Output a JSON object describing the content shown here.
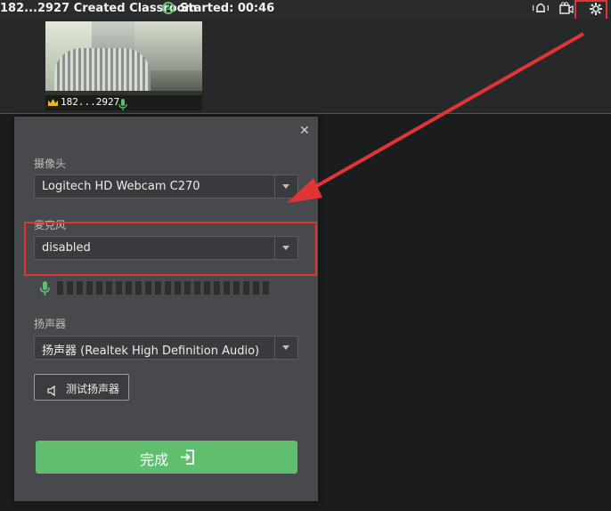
{
  "topbar": {
    "title": "182...2927 Created Classroom",
    "started": "Started: 00:46"
  },
  "video": {
    "participant": "182...2927"
  },
  "dialog": {
    "camera_label": "摄像头",
    "camera_value": "Logitech HD Webcam C270",
    "mic_label": "麦克风",
    "mic_value": "disabled",
    "speaker_label": "扬声器",
    "speaker_value": "扬声器 (Realtek High Definition Audio)",
    "test_speaker": "测试扬声器",
    "done": "完成"
  },
  "colors": {
    "accent_green": "#5fbf6e",
    "highlight_red": "#e23434"
  }
}
